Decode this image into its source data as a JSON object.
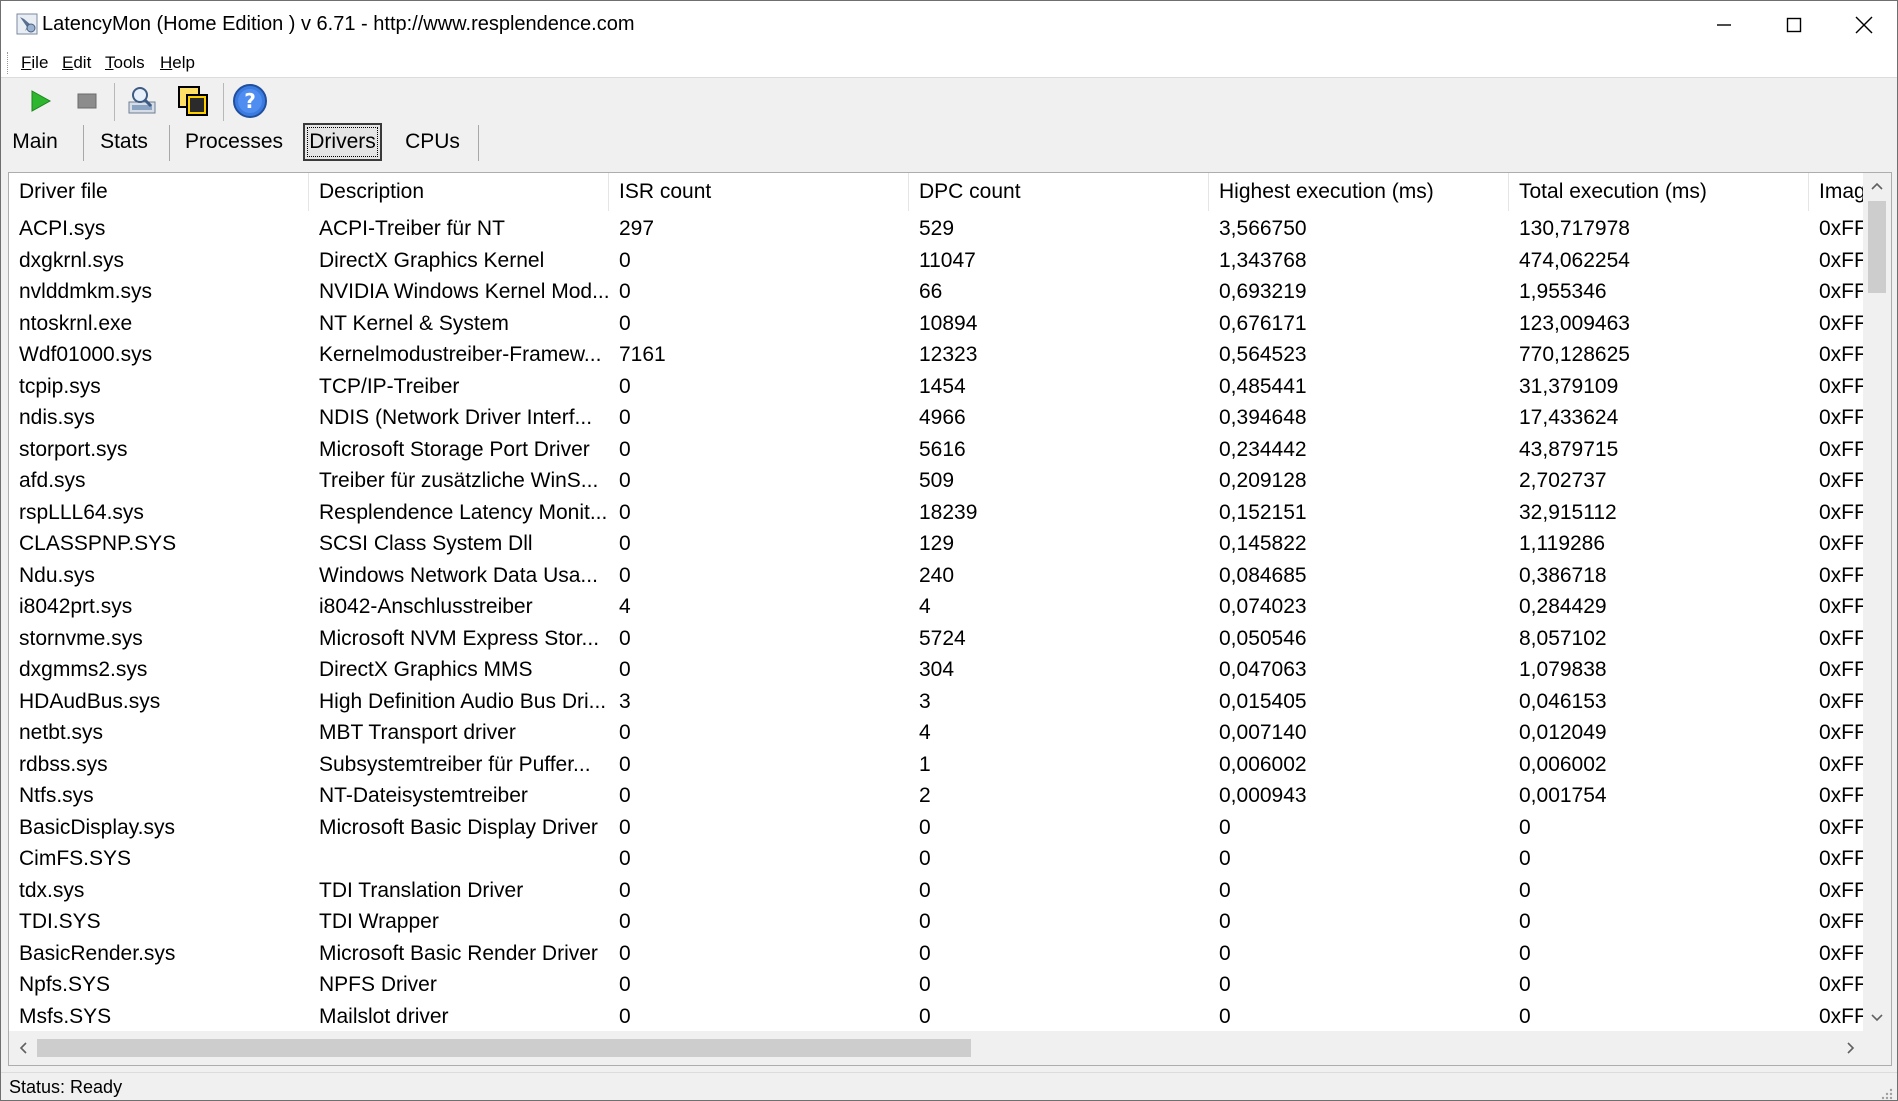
{
  "window": {
    "title": "LatencyMon  (Home Edition )  v 6.71 - http://www.resplendence.com"
  },
  "menu": [
    {
      "label": "File",
      "u": "F",
      "rest": "ile"
    },
    {
      "label": "Edit",
      "u": "E",
      "rest": "dit"
    },
    {
      "label": "Tools",
      "u": "T",
      "rest": "ools"
    },
    {
      "label": "Help",
      "u": "H",
      "rest": "elp"
    }
  ],
  "toolbar": {
    "icons": [
      "play-icon",
      "stop-icon",
      "analyze-icon",
      "copy-windows-icon",
      "help-icon"
    ]
  },
  "tabs": [
    {
      "label": "Main",
      "active": false
    },
    {
      "label": "Stats",
      "active": false
    },
    {
      "label": "Processes",
      "active": false
    },
    {
      "label": "Drivers",
      "active": true
    },
    {
      "label": "CPUs",
      "active": false
    }
  ],
  "table": {
    "columns": [
      "Driver file",
      "Description",
      "ISR count",
      "DPC count",
      "Highest execution (ms)",
      "Total execution (ms)",
      "Imag"
    ],
    "rows": [
      [
        "ACPI.sys",
        "ACPI-Treiber für NT",
        "297",
        "529",
        "3,566750",
        "130,717978",
        "0xFF"
      ],
      [
        "dxgkrnl.sys",
        "DirectX Graphics Kernel",
        "0",
        "11047",
        "1,343768",
        "474,062254",
        "0xFF"
      ],
      [
        "nvlddmkm.sys",
        "NVIDIA Windows Kernel Mod...",
        "0",
        "66",
        "0,693219",
        "1,955346",
        "0xFF"
      ],
      [
        "ntoskrnl.exe",
        "NT Kernel & System",
        "0",
        "10894",
        "0,676171",
        "123,009463",
        "0xFF"
      ],
      [
        "Wdf01000.sys",
        "Kernelmodustreiber-Framew...",
        "7161",
        "12323",
        "0,564523",
        "770,128625",
        "0xFF"
      ],
      [
        "tcpip.sys",
        "TCP/IP-Treiber",
        "0",
        "1454",
        "0,485441",
        "31,379109",
        "0xFF"
      ],
      [
        "ndis.sys",
        "NDIS (Network Driver Interf...",
        "0",
        "4966",
        "0,394648",
        "17,433624",
        "0xFF"
      ],
      [
        "storport.sys",
        "Microsoft Storage Port Driver",
        "0",
        "5616",
        "0,234442",
        "43,879715",
        "0xFF"
      ],
      [
        "afd.sys",
        "Treiber für zusätzliche WinS...",
        "0",
        "509",
        "0,209128",
        "2,702737",
        "0xFF"
      ],
      [
        "rspLLL64.sys",
        "Resplendence Latency Monit...",
        "0",
        "18239",
        "0,152151",
        "32,915112",
        "0xFF"
      ],
      [
        "CLASSPNP.SYS",
        "SCSI Class System Dll",
        "0",
        "129",
        "0,145822",
        "1,119286",
        "0xFF"
      ],
      [
        "Ndu.sys",
        "Windows Network Data Usa...",
        "0",
        "240",
        "0,084685",
        "0,386718",
        "0xFF"
      ],
      [
        "i8042prt.sys",
        "i8042-Anschlusstreiber",
        "4",
        "4",
        "0,074023",
        "0,284429",
        "0xFF"
      ],
      [
        "stornvme.sys",
        "Microsoft NVM Express Stor...",
        "0",
        "5724",
        "0,050546",
        "8,057102",
        "0xFF"
      ],
      [
        "dxgmms2.sys",
        "DirectX Graphics MMS",
        "0",
        "304",
        "0,047063",
        "1,079838",
        "0xFF"
      ],
      [
        "HDAudBus.sys",
        "High Definition Audio Bus Dri...",
        "3",
        "3",
        "0,015405",
        "0,046153",
        "0xFF"
      ],
      [
        "netbt.sys",
        "MBT Transport driver",
        "0",
        "4",
        "0,007140",
        "0,012049",
        "0xFF"
      ],
      [
        "rdbss.sys",
        "Subsystemtreiber für Puffer...",
        "0",
        "1",
        "0,006002",
        "0,006002",
        "0xFF"
      ],
      [
        "Ntfs.sys",
        "NT-Dateisystemtreiber",
        "0",
        "2",
        "0,000943",
        "0,001754",
        "0xFF"
      ],
      [
        "BasicDisplay.sys",
        "Microsoft Basic Display Driver",
        "0",
        "0",
        "0",
        "0",
        "0xFF"
      ],
      [
        "CimFS.SYS",
        "",
        "0",
        "0",
        "0",
        "0",
        "0xFF"
      ],
      [
        "tdx.sys",
        "TDI Translation Driver",
        "0",
        "0",
        "0",
        "0",
        "0xFF"
      ],
      [
        "TDI.SYS",
        "TDI Wrapper",
        "0",
        "0",
        "0",
        "0",
        "0xFF"
      ],
      [
        "BasicRender.sys",
        "Microsoft Basic Render Driver",
        "0",
        "0",
        "0",
        "0",
        "0xFF"
      ],
      [
        "Npfs.SYS",
        "NPFS Driver",
        "0",
        "0",
        "0",
        "0",
        "0xFF"
      ],
      [
        "Msfs.SYS",
        "Mailslot driver",
        "0",
        "0",
        "0",
        "0",
        "0xFF"
      ]
    ]
  },
  "status": {
    "text": "Status: Ready"
  }
}
